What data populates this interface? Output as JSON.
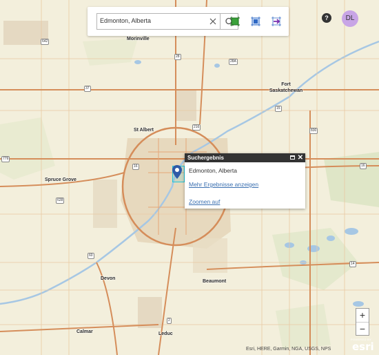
{
  "search": {
    "value": "Edmonton, Alberta"
  },
  "user": {
    "initials": "DL"
  },
  "help": {
    "label": "?"
  },
  "popup": {
    "title": "Suchergebnis",
    "result": "Edmonton, Alberta",
    "more_link": "Mehr Ergebnisse anzeigen",
    "zoom_link": "Zoomen auf"
  },
  "zoom": {
    "in": "+",
    "out": "−"
  },
  "attribution": "Esri, HERE, Garmin, NGA, USGS, NPS",
  "esri_logo": {
    "powered": "POWERED BY",
    "name": "esri"
  },
  "places": {
    "morinville": "Morinville",
    "fort_sask": "Fort Saskatchewan",
    "st_albert": "St Albert",
    "spruce_grove": "Spruce Grove",
    "devon": "Devon",
    "beaumont": "Beaumont",
    "calmar": "Calmar",
    "leduc": "Leduc"
  },
  "shields": {
    "s642": "642",
    "s28": "28",
    "s28a": "28A",
    "s37": "37",
    "s216a": "216",
    "s16": "16",
    "s779": "779",
    "s628": "628",
    "s60": "60",
    "s830": "830",
    "s15": "15",
    "s16e": "16",
    "s14": "14",
    "s2": "2"
  },
  "colors": {
    "accent_green": "#3aa13a",
    "toolbar_blue": "#2e68c4",
    "link": "#3a6fb0",
    "avatar": "#c8a5e6"
  }
}
